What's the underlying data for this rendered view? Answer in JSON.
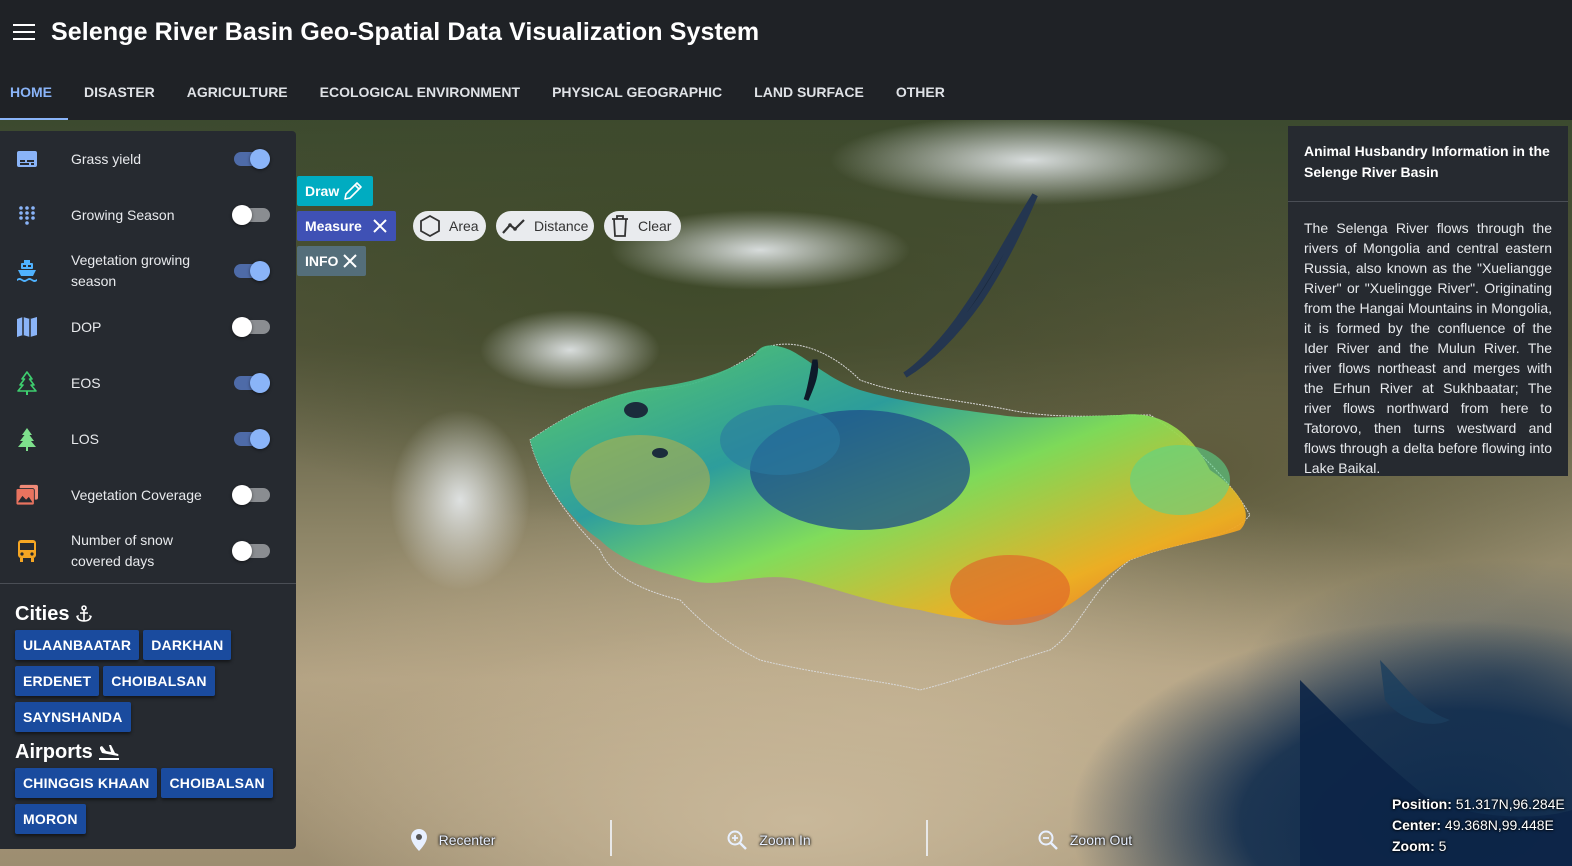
{
  "header": {
    "title": "Selenge River Basin Geo-Spatial Data Visualization System",
    "menu_icon": "hamburger-menu-icon"
  },
  "tabs": [
    {
      "label": "HOME",
      "active": true
    },
    {
      "label": "DISASTER"
    },
    {
      "label": "AGRICULTURE"
    },
    {
      "label": "ECOLOGICAL ENVIRONMENT"
    },
    {
      "label": "PHYSICAL GEOGRAPHIC"
    },
    {
      "label": "LAND SURFACE"
    },
    {
      "label": "OTHER"
    }
  ],
  "layers": [
    {
      "label": "Grass yield",
      "icon": "subtitles-icon",
      "on": true
    },
    {
      "label": "Growing Season",
      "icon": "dots-grid-icon",
      "on": false
    },
    {
      "label": "Vegetation growing season",
      "icon": "ferry-icon",
      "on": true
    },
    {
      "label": "DOP",
      "icon": "map-icon",
      "on": false
    },
    {
      "label": "EOS",
      "icon": "pine-tree-outline-icon",
      "on": true
    },
    {
      "label": "LOS",
      "icon": "pine-tree-icon",
      "on": true
    },
    {
      "label": "Vegetation Coverage",
      "icon": "image-multiple-icon",
      "on": false
    },
    {
      "label": "Number of snow covered days",
      "icon": "bus-icon",
      "on": false
    }
  ],
  "cities": {
    "title": "Cities",
    "icon": "anchor-icon",
    "items": [
      "ULAANBAATAR",
      "DARKHAN",
      "ERDENET",
      "CHOIBALSAN",
      "SAYNSHANDA"
    ]
  },
  "airports": {
    "title": "Airports",
    "icon": "airplane-landing-icon",
    "items": [
      "CHINGGIS KHAAN",
      "CHOIBALSAN",
      "MORON"
    ]
  },
  "tools": {
    "draw": "Draw",
    "measure": "Measure",
    "info": "INFO",
    "area": "Area",
    "distance": "Distance",
    "clear": "Clear"
  },
  "info_panel": {
    "title": "Animal Husbandry Information in the Selenge River Basin",
    "body": "The Selenga River flows through the rivers of Mongolia and central eastern Russia, also known as the \"Xueliangge River\" or \"Xuelingge River\". Originating from the Hangai Mountains in Mongolia, it is formed by the confluence of the Ider River and the Mulun River. The river flows northeast and merges with the Erhun River at Sukhbaatar; The river flows northward from here to Tatorovo, then turns westward and flows through a delta before flowing into Lake Baikal."
  },
  "map_controls": {
    "recenter": "Recenter",
    "zoom_in": "Zoom In",
    "zoom_out": "Zoom Out"
  },
  "status": {
    "position_label": "Position:",
    "position_value": "51.317N,96.284E",
    "center_label": "Center:",
    "center_value": "49.368N,99.448E",
    "zoom_label": "Zoom:",
    "zoom_value": "5"
  },
  "colors": {
    "accent": "#8ab4f8",
    "chip": "#1a4b9e",
    "draw": "#00acc1",
    "measure": "#3f51b5",
    "info": "#546e7a"
  }
}
